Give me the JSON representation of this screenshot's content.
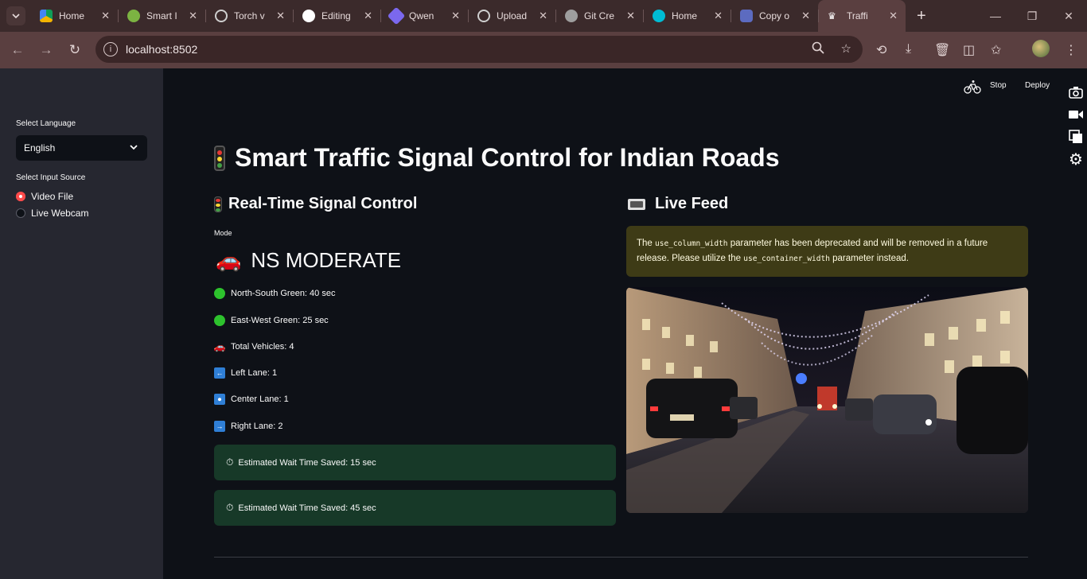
{
  "browser": {
    "tabs": [
      {
        "title": "Home",
        "color": "#f4b400"
      },
      {
        "title": "Smart I",
        "color": "#7cb342"
      },
      {
        "title": "Torch v",
        "color": "#cfcfcf"
      },
      {
        "title": "Editing",
        "color": "#ffffff"
      },
      {
        "title": "Qwen",
        "color": "#7b68ee"
      },
      {
        "title": "Upload",
        "color": "#cfcfcf"
      },
      {
        "title": "Git Cre",
        "color": "#9e9e9e"
      },
      {
        "title": "Home",
        "color": "#00bcd4"
      },
      {
        "title": "Copy o",
        "color": "#5c6bc0"
      },
      {
        "title": "Traffi",
        "color": "#ffffff"
      }
    ],
    "url": "localhost:8502"
  },
  "sidebar": {
    "language_label": "Select Language",
    "language_value": "English",
    "source_label": "Select Input Source",
    "source_options": [
      "Video File",
      "Live Webcam"
    ]
  },
  "header": {
    "stop_label": "Stop",
    "deploy_label": "Deploy"
  },
  "main": {
    "title": "Smart Traffic Signal Control for Indian Roads",
    "left_heading": "Real-Time Signal Control",
    "right_heading": "Live Feed",
    "mode_label": "Mode",
    "mode_value": "NS MODERATE",
    "stats": [
      "North-South Green: 40 sec",
      "East-West Green: 25 sec",
      "Total Vehicles: 4",
      "Left Lane: 1",
      "Center Lane: 1",
      "Right Lane: 2"
    ],
    "success_messages": [
      "Estimated Wait Time Saved: 15 sec",
      "Estimated Wait Time Saved: 45 sec"
    ],
    "warning": {
      "p1": "The ",
      "code1": "use_column_width",
      "p2": " parameter has been deprecated and will be removed in a future release. Please utilize the ",
      "code2": "use_container_width",
      "p3": " parameter instead."
    }
  },
  "colors": {
    "accent": "#ff4b4b",
    "success_bg": "#173928",
    "warning_bg": "#3e3b16",
    "sidebar_bg": "#262730",
    "main_bg": "#0e1117"
  }
}
